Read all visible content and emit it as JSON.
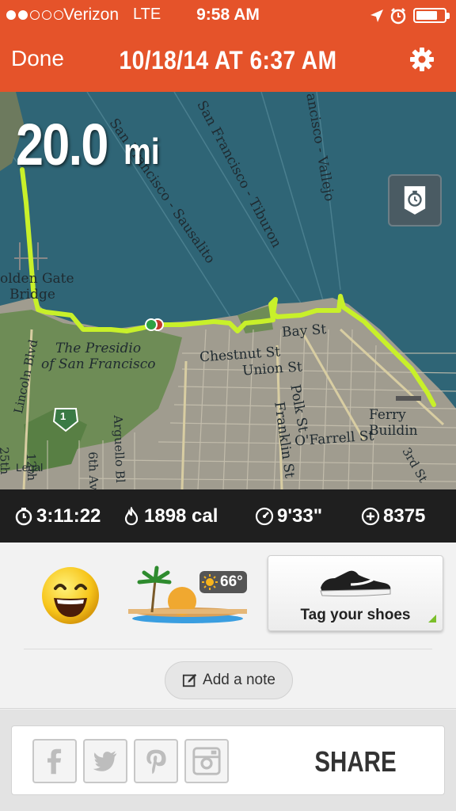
{
  "status_bar": {
    "carrier": "Verizon",
    "network": "LTE",
    "time": "9:58 AM",
    "signal_bars_filled": 2,
    "signal_bars_total": 5,
    "icons": [
      "location-arrow-icon",
      "alarm-clock-icon",
      "battery-icon"
    ]
  },
  "header": {
    "done_label": "Done",
    "title": "10/18/14 AT 6:37 AM",
    "settings_icon": "gear-icon",
    "background_color": "#e5532a"
  },
  "map": {
    "distance_value": "20.0",
    "distance_unit": "mi",
    "route_color": "#c8f02a",
    "labels": {
      "sf_sausalito": "San Francisco - Sausalito",
      "sf_tiburon": "San Francisco - Tiburon",
      "sf_vallejo": "ancisco - Vallejo",
      "golden_gate_1": "olden Gate",
      "golden_gate_2": "Bridge",
      "presidio_1": "The Presidio",
      "presidio_2": "of San Francisco",
      "lincoln": "Lincoln Blvd",
      "chestnut": "Chestnut St",
      "union": "Union St",
      "bay": "Bay St",
      "polk": "Polk St",
      "franklin": "Franklin St",
      "ofarrell": "O'Farrell St",
      "ferry": "Ferry Buildin",
      "third": "3rd St",
      "arguello": "Arguello Bl",
      "sixth": "6th Av",
      "twelfth": "12th",
      "twentyfifth": "25th",
      "legal": "Legal",
      "shield": "1"
    },
    "splits_icon": "stopwatch-icon"
  },
  "stats": {
    "duration": "3:11:22",
    "calories": "1898 cal",
    "pace": "9'33\"",
    "fuel": "8375"
  },
  "tags": {
    "mood_icon": "happy-face-icon",
    "weather_icon": "sunny-island-icon",
    "temperature": "66°",
    "shoes_label": "Tag your shoes",
    "note_label": "Add a note"
  },
  "share": {
    "label": "SHARE",
    "networks": [
      "facebook-icon",
      "twitter-icon",
      "pinterest-icon",
      "instagram-icon"
    ]
  }
}
